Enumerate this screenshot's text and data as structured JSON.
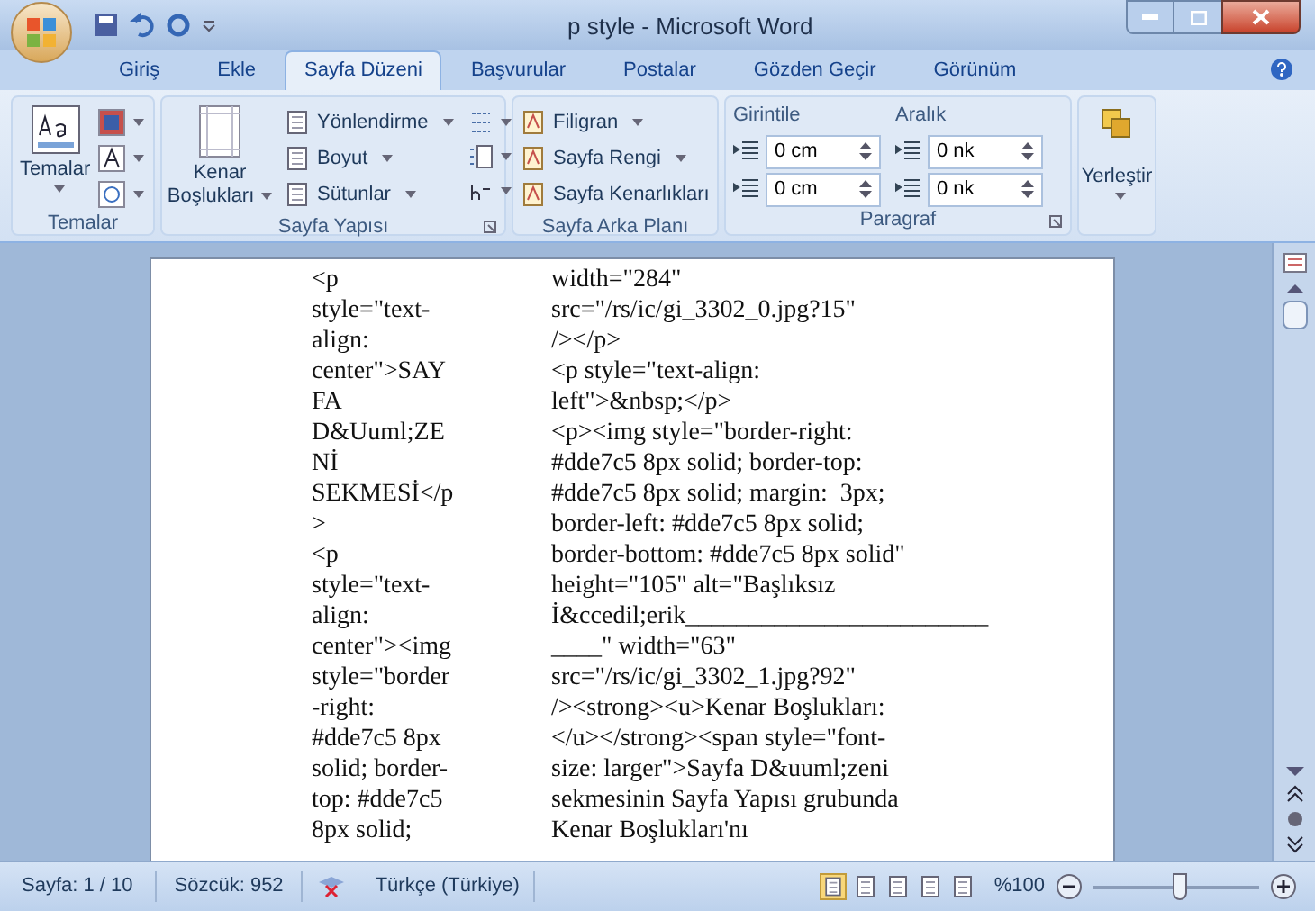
{
  "window": {
    "title": "p style - Microsoft Word"
  },
  "tabs": [
    {
      "label": "Giriş",
      "selected": false
    },
    {
      "label": "Ekle",
      "selected": false
    },
    {
      "label": "Sayfa Düzeni",
      "selected": true
    },
    {
      "label": "Başvurular",
      "selected": false
    },
    {
      "label": "Postalar",
      "selected": false
    },
    {
      "label": "Gözden Geçir",
      "selected": false
    },
    {
      "label": "Görünüm",
      "selected": false
    }
  ],
  "ribbon": {
    "temalar": {
      "button": "Temalar",
      "label": "Temalar"
    },
    "sayfa_yapisi": {
      "margins_button": [
        "Kenar",
        "Boşlukları"
      ],
      "buttons": [
        "Yönlendirme",
        "Boyut",
        "Sütunlar"
      ],
      "label": "Sayfa Yapısı"
    },
    "sayfa_arka_plani": {
      "buttons": [
        "Filigran",
        "Sayfa Rengi",
        "Sayfa Kenarlıkları"
      ],
      "label": "Sayfa Arka Planı"
    },
    "paragraf": {
      "indent_title": "Girintile",
      "indent_values": [
        "0 cm",
        "0 cm"
      ],
      "spacing_title": "Aralık",
      "spacing_values": [
        "0 nk",
        "0 nk"
      ],
      "label": "Paragraf"
    },
    "yerlestir": {
      "button": "Yerleştir"
    }
  },
  "document": {
    "left_lines": [
      "<p",
      "style=\"text-",
      "align:",
      "center\">SAY",
      "FA",
      "D&Uuml;ZE",
      "Nİ",
      "SEKMESİ</p",
      ">",
      "<p",
      "style=\"text-",
      "align:",
      "center\"><img",
      "style=\"border",
      "-right:",
      "#dde7c5 8px",
      "solid; border-",
      "top: #dde7c5",
      "8px solid;"
    ],
    "right_lines": [
      "width=\"284\"",
      "src=\"/rs/ic/gi_3302_0.jpg?15\"",
      "/></p>",
      "<p style=\"text-align:",
      "left\">&nbsp;</p>",
      "<p><img style=\"border-right:",
      "#dde7c5 8px solid; border-top:",
      "#dde7c5 8px solid; margin:  3px;",
      "border-left: #dde7c5 8px solid;",
      "border-bottom: #dde7c5 8px solid\"",
      "height=\"105\" alt=\"Başlıksız",
      "İ&ccedil;erik________________________",
      "____\" width=\"63\"",
      "src=\"/rs/ic/gi_3302_1.jpg?92\"",
      "/><strong><u>Kenar Boşlukları:",
      "</u></strong><span style=\"font-",
      "size: larger\">Sayfa D&uuml;zeni",
      "sekmesinin Sayfa Yapısı grubunda",
      "Kenar Boşlukları'nı"
    ]
  },
  "status_bar": {
    "page": "Sayfa: 1 / 10",
    "words": "Sözcük: 952",
    "language": "Türkçe (Türkiye)",
    "zoom": "%100",
    "zoom_slider": {
      "level": 0.52
    }
  }
}
